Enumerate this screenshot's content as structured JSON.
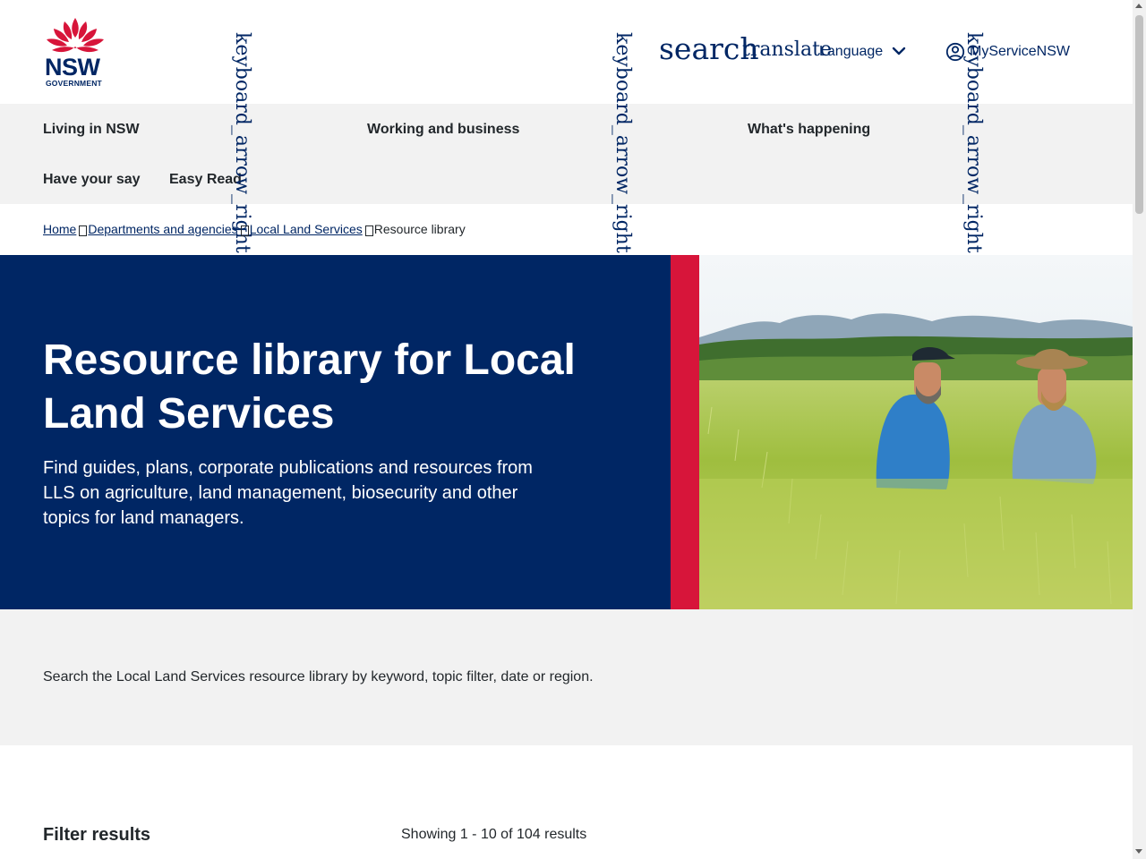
{
  "header": {
    "logo_text": "NSW",
    "logo_subtext": "GOVERNMENT",
    "search_icon_text": "search",
    "translate_icon_text": "translate",
    "language_label": "Language",
    "account_label": "MyServiceNSW",
    "icon_names": [
      "waratah-logo",
      "search-icon",
      "translate-icon",
      "chevron-down-icon",
      "account-circle-icon"
    ]
  },
  "icon_fallback_text": "keyboard_arrow_right",
  "nav": {
    "items": [
      {
        "label": "Living in NSW"
      },
      {
        "label": "Working and business"
      },
      {
        "label": "What's happening"
      },
      {
        "label": "Have your say"
      },
      {
        "label": "Easy Read"
      }
    ]
  },
  "breadcrumb": {
    "items": [
      {
        "label": "Home"
      },
      {
        "label": "Departments and agencies"
      },
      {
        "label": "Local Land Services"
      }
    ],
    "current": "Resource library"
  },
  "hero": {
    "title": "Resource library for Local Land Services",
    "intro": "Find guides, plans, corporate publications and resources from LLS on agriculture, land management, biosecurity and other topics for land managers."
  },
  "search_band": {
    "text": "Search the Local Land Services resource library by keyword, topic filter, date or region."
  },
  "results": {
    "filter_title": "Filter results",
    "count_text": "Showing 1 - 10 of 104 results"
  },
  "colors": {
    "brand_navy": "#002664",
    "brand_red": "#d7153a",
    "band_grey": "#f2f2f2",
    "text": "#22272b"
  }
}
